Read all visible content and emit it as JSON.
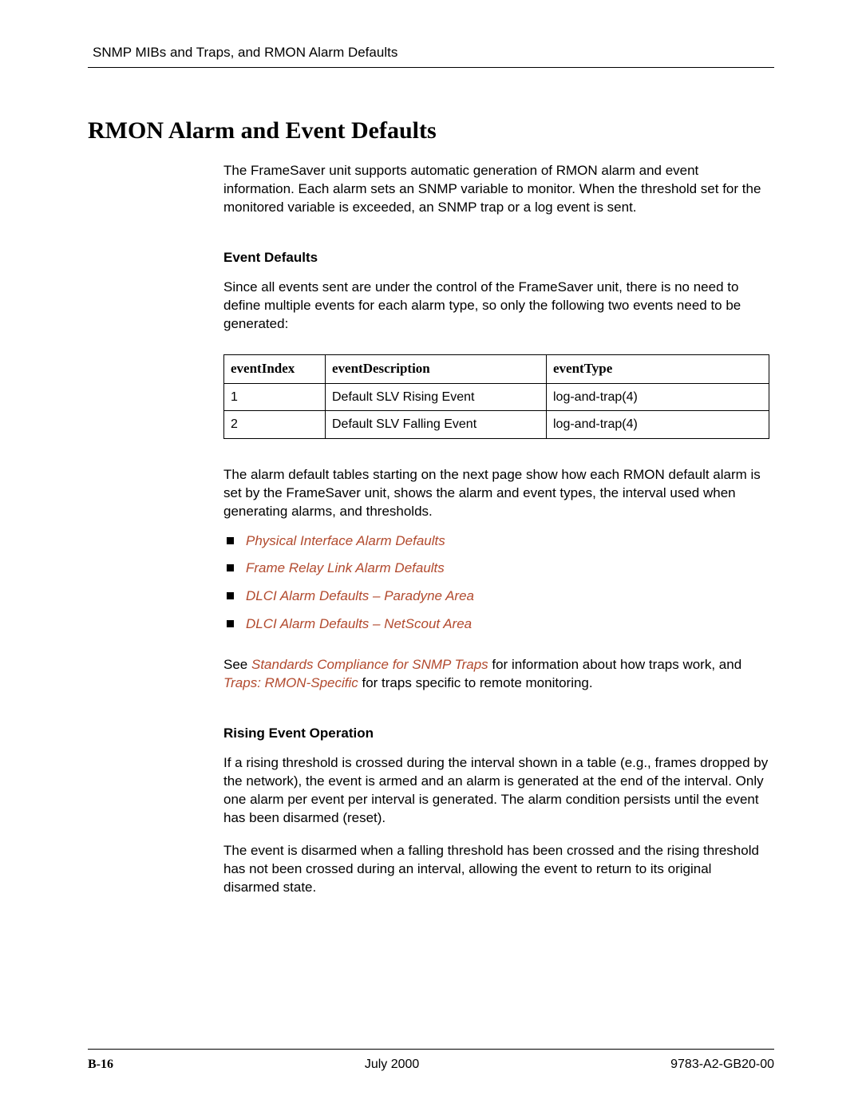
{
  "running_head": "SNMP MIBs and Traps, and RMON Alarm Defaults",
  "title": "RMON Alarm and Event Defaults",
  "intro": "The FrameSaver unit supports automatic generation of RMON alarm and event information. Each alarm sets an SNMP variable to monitor. When the threshold set for the monitored variable is exceeded, an SNMP trap or a log event is sent.",
  "event_defaults": {
    "heading": "Event Defaults",
    "para": "Since all events sent are under the control of the FrameSaver unit, there is no need to define multiple events for each alarm type, so only the following two events need to be generated:",
    "headers": {
      "idx": "eventIndex",
      "desc": "eventDescription",
      "type": "eventType"
    },
    "rows": [
      {
        "idx": "1",
        "desc": "Default SLV Rising Event",
        "type": "log-and-trap(4)"
      },
      {
        "idx": "2",
        "desc": "Default SLV Falling Event",
        "type": "log-and-trap(4)"
      }
    ]
  },
  "after_table": "The alarm default tables starting on the next page show how each RMON default alarm is set by the FrameSaver unit, shows the alarm and event types, the interval used when generating alarms, and thresholds.",
  "links": [
    "Physical Interface Alarm Defaults",
    "Frame Relay Link Alarm Defaults",
    "DLCI Alarm Defaults – Paradyne Area",
    "DLCI Alarm Defaults – NetScout Area"
  ],
  "see_para": {
    "pre": "See ",
    "link1": "Standards Compliance for SNMP Traps",
    "mid": " for information about how traps work, and ",
    "link2": "Traps: RMON-Specific",
    "post": " for traps specific to remote monitoring."
  },
  "rising": {
    "heading": "Rising Event Operation",
    "p1": "If a rising threshold is crossed during the interval shown in a table (e.g., frames dropped by the network), the event is armed and an alarm is generated at the end of the interval. Only one alarm per event per interval is generated. The alarm condition persists until the event has been disarmed (reset).",
    "p2": "The event is disarmed when a falling threshold has been crossed and the rising threshold has not been crossed during an interval, allowing the event to return to its original disarmed state."
  },
  "footer": {
    "page": "B-16",
    "date": "July 2000",
    "doc": "9783-A2-GB20-00"
  }
}
